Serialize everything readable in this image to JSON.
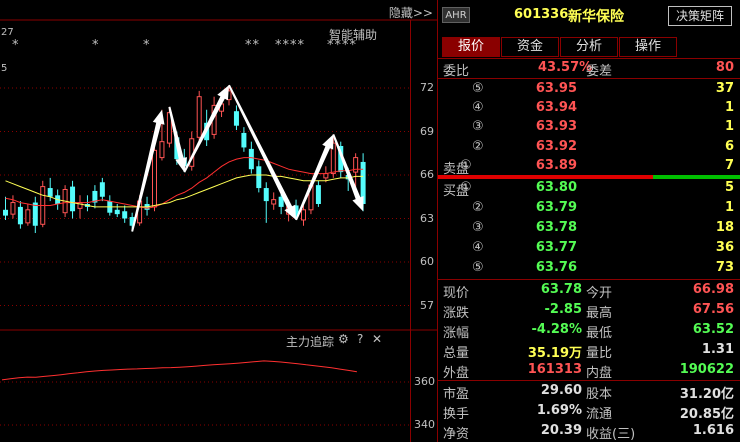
{
  "chart_panel": {
    "hide_label": "隐藏>>",
    "partial_left_label": "27",
    "partial_axis_label": "5",
    "assist_label": "智能辅助",
    "star_groups": [
      {
        "text": "*",
        "left": 12
      },
      {
        "text": "*",
        "left": 92
      },
      {
        "text": "*",
        "left": 143
      },
      {
        "text": "**",
        "left": 245
      },
      {
        "text": "****",
        "left": 275
      },
      {
        "text": "****",
        "left": 327
      }
    ],
    "price_axis": [
      "72",
      "69",
      "66",
      "63",
      "60",
      "57"
    ],
    "indicator_title": "主力追踪",
    "indicator_axis": [
      "360",
      "340"
    ],
    "icons": {
      "gear": "⚙",
      "help": "?",
      "close": "✕"
    }
  },
  "chart_data": {
    "type": "candlestick",
    "title": "",
    "ylim": [
      55.5,
      73.5
    ],
    "price_ticks": [
      72,
      69,
      66,
      63,
      60,
      57
    ],
    "candles": [
      {
        "o": 63.6,
        "c": 63.2,
        "h": 64.5,
        "l": 62.9
      },
      {
        "o": 63.3,
        "c": 64.1,
        "h": 64.6,
        "l": 63.0
      },
      {
        "o": 63.8,
        "c": 62.6,
        "h": 64.2,
        "l": 62.3
      },
      {
        "o": 62.7,
        "c": 63.6,
        "h": 64.0,
        "l": 62.5
      },
      {
        "o": 64.1,
        "c": 62.5,
        "h": 64.5,
        "l": 62.0
      },
      {
        "o": 62.6,
        "c": 65.2,
        "h": 65.6,
        "l": 62.4
      },
      {
        "o": 65.1,
        "c": 64.5,
        "h": 65.8,
        "l": 64.2
      },
      {
        "o": 64.6,
        "c": 64.0,
        "h": 65.0,
        "l": 63.6
      },
      {
        "o": 63.4,
        "c": 65.0,
        "h": 65.3,
        "l": 63.1
      },
      {
        "o": 65.2,
        "c": 63.5,
        "h": 65.6,
        "l": 63.0
      },
      {
        "o": 63.7,
        "c": 64.1,
        "h": 64.6,
        "l": 63.0
      },
      {
        "o": 64.0,
        "c": 63.8,
        "h": 64.6,
        "l": 63.5
      },
      {
        "o": 64.9,
        "c": 64.1,
        "h": 65.3,
        "l": 63.7
      },
      {
        "o": 65.5,
        "c": 64.5,
        "h": 65.8,
        "l": 64.2
      },
      {
        "o": 64.2,
        "c": 63.4,
        "h": 64.6,
        "l": 63.2
      },
      {
        "o": 63.6,
        "c": 63.3,
        "h": 64.0,
        "l": 63.1
      },
      {
        "o": 63.5,
        "c": 63.0,
        "h": 63.9,
        "l": 62.7
      },
      {
        "o": 63.1,
        "c": 62.5,
        "h": 63.4,
        "l": 62.1
      },
      {
        "o": 62.7,
        "c": 64.2,
        "h": 64.6,
        "l": 62.5
      },
      {
        "o": 64.0,
        "c": 63.6,
        "h": 64.5,
        "l": 63.2
      },
      {
        "o": 63.8,
        "c": 67.7,
        "h": 68.1,
        "l": 63.5
      },
      {
        "o": 67.2,
        "c": 68.3,
        "h": 70.5,
        "l": 67.0
      },
      {
        "o": 68.2,
        "c": 70.3,
        "h": 70.7,
        "l": 67.9
      },
      {
        "o": 68.6,
        "c": 67.1,
        "h": 69.0,
        "l": 66.7
      },
      {
        "o": 67.2,
        "c": 66.6,
        "h": 67.8,
        "l": 66.2
      },
      {
        "o": 66.6,
        "c": 68.5,
        "h": 69.0,
        "l": 66.3
      },
      {
        "o": 68.6,
        "c": 71.4,
        "h": 71.8,
        "l": 68.3
      },
      {
        "o": 69.6,
        "c": 68.4,
        "h": 70.5,
        "l": 68.0
      },
      {
        "o": 68.8,
        "c": 70.8,
        "h": 71.4,
        "l": 68.5
      },
      {
        "o": 70.4,
        "c": 70.9,
        "h": 71.6,
        "l": 70.0
      },
      {
        "o": 71.2,
        "c": 71.8,
        "h": 72.2,
        "l": 70.8
      },
      {
        "o": 70.4,
        "c": 69.4,
        "h": 70.8,
        "l": 69.1
      },
      {
        "o": 68.9,
        "c": 67.9,
        "h": 69.3,
        "l": 67.6
      },
      {
        "o": 67.8,
        "c": 66.4,
        "h": 68.3,
        "l": 66.1
      },
      {
        "o": 66.6,
        "c": 65.1,
        "h": 67.0,
        "l": 64.8
      },
      {
        "o": 65.1,
        "c": 64.2,
        "h": 65.5,
        "l": 62.7
      },
      {
        "o": 64.0,
        "c": 64.3,
        "h": 64.8,
        "l": 63.6
      },
      {
        "o": 64.5,
        "c": 63.8,
        "h": 64.9,
        "l": 63.3
      },
      {
        "o": 63.3,
        "c": 63.8,
        "h": 64.3,
        "l": 62.8
      },
      {
        "o": 63.9,
        "c": 63.1,
        "h": 64.3,
        "l": 62.9
      },
      {
        "o": 62.9,
        "c": 63.6,
        "h": 63.9,
        "l": 62.5
      },
      {
        "o": 63.6,
        "c": 65.3,
        "h": 65.6,
        "l": 63.3
      },
      {
        "o": 65.3,
        "c": 64.0,
        "h": 65.6,
        "l": 63.8
      },
      {
        "o": 65.8,
        "c": 66.1,
        "h": 66.6,
        "l": 65.5
      },
      {
        "o": 66.1,
        "c": 68.2,
        "h": 68.8,
        "l": 65.8
      },
      {
        "o": 68.0,
        "c": 66.2,
        "h": 68.3,
        "l": 65.8
      },
      {
        "o": 66.0,
        "c": 65.7,
        "h": 66.5,
        "l": 64.9
      },
      {
        "o": 66.2,
        "c": 67.2,
        "h": 67.5,
        "l": 64.8
      },
      {
        "o": 66.9,
        "c": 64.0,
        "h": 67.5,
        "l": 63.5
      }
    ],
    "ma_red": [
      64.4,
      64.3,
      64.1,
      64.0,
      63.9,
      63.9,
      63.9,
      64.0,
      64.1,
      64.1,
      64.1,
      64.1,
      64.2,
      64.3,
      64.2,
      64.1,
      64.0,
      63.9,
      63.8,
      63.7,
      63.8,
      64.0,
      64.3,
      64.6,
      64.8,
      65.1,
      65.5,
      65.8,
      66.2,
      66.6,
      66.9,
      67.1,
      67.2,
      67.2,
      67.1,
      67.0,
      66.8,
      66.6,
      66.4,
      66.3,
      66.2,
      66.1,
      66.1,
      66.1,
      66.2,
      66.3,
      66.3,
      66.4,
      66.4
    ],
    "ma_yellow": [
      65.6,
      65.4,
      65.2,
      65.0,
      64.8,
      64.6,
      64.5,
      64.3,
      64.2,
      64.1,
      64.0,
      63.9,
      63.8,
      63.8,
      63.8,
      63.8,
      63.8,
      63.8,
      63.8,
      63.8,
      63.9,
      64.0,
      64.1,
      64.3,
      64.4,
      64.6,
      64.8,
      65.0,
      65.2,
      65.4,
      65.6,
      65.8,
      65.9,
      66.0,
      66.0,
      66.0,
      65.9,
      65.9,
      65.8,
      65.7,
      65.6,
      65.6,
      65.6,
      65.6,
      65.7,
      65.8,
      65.8,
      65.9,
      65.9
    ],
    "arrows": [
      {
        "from": 17,
        "to": 21,
        "up": true
      },
      {
        "from": 22,
        "to": 24,
        "up": false
      },
      {
        "from": 24,
        "to": 30,
        "up": true
      },
      {
        "from": 30,
        "to": 39,
        "up": false
      },
      {
        "from": 39,
        "to": 44,
        "up": true
      },
      {
        "from": 44,
        "to": 48,
        "up": false
      }
    ],
    "indicator": {
      "ylim": [
        330,
        375
      ],
      "values": [
        361,
        361.5,
        362,
        362.3,
        362.2,
        362.6,
        363,
        363.4,
        363.9,
        364.3,
        364.8,
        365.1,
        365.4,
        365.6,
        365.8,
        366,
        366.1,
        366.3,
        366.4,
        366.6,
        366.7,
        366.9,
        367.1,
        367.4,
        367.7,
        368,
        368.3,
        368.5,
        368.8,
        369.1,
        369.5,
        369.8,
        369.6,
        369.3,
        368.9,
        368.5,
        368,
        367.6,
        367.1,
        366.6,
        366,
        365.4,
        364.8
      ]
    }
  },
  "quote": {
    "badge": "AHR",
    "code": "601336",
    "name": "新华保险",
    "decision_label": "决策矩阵",
    "tabs": [
      "报价",
      "资金",
      "分析",
      "操作"
    ],
    "webi": {
      "label1": "委比",
      "value1": "43.57%",
      "label2": "委差",
      "value2": "80"
    },
    "sell": [
      {
        "lbl": "",
        "circ": "⑤",
        "price": "63.95",
        "vol": "37"
      },
      {
        "lbl": "",
        "circ": "④",
        "price": "63.94",
        "vol": "1"
      },
      {
        "lbl": "",
        "circ": "③",
        "price": "63.93",
        "vol": "1"
      },
      {
        "lbl": "",
        "circ": "②",
        "price": "63.92",
        "vol": "6"
      },
      {
        "lbl": "卖盘",
        "circ": "①",
        "price": "63.89",
        "vol": "7"
      }
    ],
    "buy": [
      {
        "lbl": "买盘",
        "circ": "①",
        "price": "63.80",
        "vol": "5"
      },
      {
        "lbl": "",
        "circ": "②",
        "price": "63.79",
        "vol": "1"
      },
      {
        "lbl": "",
        "circ": "③",
        "price": "63.78",
        "vol": "18"
      },
      {
        "lbl": "",
        "circ": "④",
        "price": "63.77",
        "vol": "36"
      },
      {
        "lbl": "",
        "circ": "⑤",
        "price": "63.76",
        "vol": "73"
      }
    ],
    "stats": [
      {
        "k1": "现价",
        "v1": "63.78",
        "c1": "green",
        "k2": "今开",
        "v2": "66.98",
        "c2": "red"
      },
      {
        "k1": "涨跌",
        "v1": "-2.85",
        "c1": "green",
        "k2": "最高",
        "v2": "67.56",
        "c2": "red"
      },
      {
        "k1": "涨幅",
        "v1": "-4.28%",
        "c1": "green",
        "k2": "最低",
        "v2": "63.52",
        "c2": "green"
      },
      {
        "k1": "总量",
        "v1": "35.19万",
        "c1": "yellow",
        "k2": "量比",
        "v2": "1.31",
        "c2": "white"
      },
      {
        "k1": "外盘",
        "v1": "161313",
        "c1": "red",
        "k2": "内盘",
        "v2": "190622",
        "c2": "green"
      }
    ],
    "fin": [
      {
        "k1": "市盈",
        "v1": "29.60",
        "k2": "股本",
        "v2": "31.20亿"
      },
      {
        "k1": "换手",
        "v1": "1.69%",
        "k2": "流通",
        "v2": "20.85亿"
      },
      {
        "k1": "净资",
        "v1": "20.39",
        "k2": "收益(三)",
        "v2": "1.616"
      }
    ],
    "colors": {
      "up": "#ff5454",
      "down": "#54fcfc",
      "quote_up": "#ff5454",
      "quote_down": "#54fc54",
      "accent": "#8a0000",
      "highlight": "#ffff54"
    }
  }
}
